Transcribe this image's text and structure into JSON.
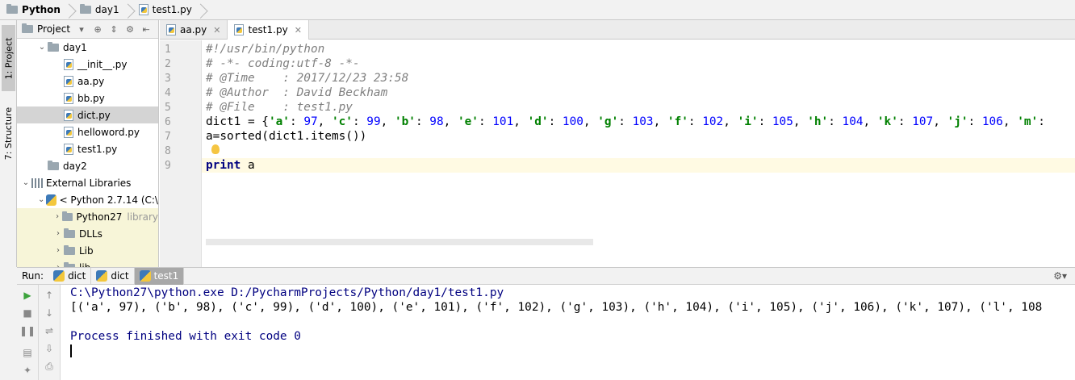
{
  "breadcrumb": {
    "project": "Python",
    "folder": "day1",
    "file": "test1.py"
  },
  "left_strip": {
    "project_tab": "1: Project",
    "structure_tab": "7: Structure"
  },
  "project_panel": {
    "title": "Project",
    "tree": [
      {
        "label": "day1",
        "arrow": "⌄",
        "type": "folder",
        "indent": 1
      },
      {
        "label": "__init__.py",
        "type": "py",
        "indent": 2
      },
      {
        "label": "aa.py",
        "type": "py",
        "indent": 2
      },
      {
        "label": "bb.py",
        "type": "py",
        "indent": 2
      },
      {
        "label": "dict.py",
        "type": "py",
        "indent": 2,
        "selected": true
      },
      {
        "label": "helloword.py",
        "type": "py",
        "indent": 2
      },
      {
        "label": "test1.py",
        "type": "py",
        "indent": 2
      },
      {
        "label": "day2",
        "type": "folder",
        "indent": 1
      },
      {
        "label": "External Libraries",
        "arrow": "⌄",
        "type": "lib",
        "indent": 0
      },
      {
        "label": "< Python 2.7.14 (C:\\",
        "arrow": "⌄",
        "type": "pyenv",
        "indent": 1
      },
      {
        "label": "Python27",
        "extra": "library",
        "arrow": "›",
        "type": "folder",
        "indent": 2,
        "ext": true
      },
      {
        "label": "DLLs",
        "arrow": "›",
        "type": "folder",
        "indent": 2,
        "ext": true
      },
      {
        "label": "Lib",
        "arrow": "›",
        "type": "folder",
        "indent": 2,
        "ext": true
      },
      {
        "label": "lib",
        "arrow": "›",
        "type": "folder",
        "indent": 2,
        "ext": true
      }
    ]
  },
  "editor_tabs": [
    {
      "label": "aa.py",
      "active": false
    },
    {
      "label": "test1.py",
      "active": true
    }
  ],
  "editor": {
    "line_numbers": [
      "1",
      "2",
      "3",
      "4",
      "5",
      "6",
      "7",
      "8",
      "9"
    ],
    "lines": {
      "l1": "#!/usr/bin/python",
      "l2": "# -*- coding:utf-8 -*-",
      "l3": "# @Time    : 2017/12/23 23:58",
      "l4": "# @Author  : David Beckham",
      "l5": "# @File    : test1.py",
      "l6_start": "dict1 = {",
      "l6_pairs": [
        [
          "'a'",
          "97"
        ],
        [
          "'c'",
          "99"
        ],
        [
          "'b'",
          "98"
        ],
        [
          "'e'",
          "101"
        ],
        [
          "'d'",
          "100"
        ],
        [
          "'g'",
          "103"
        ],
        [
          "'f'",
          "102"
        ],
        [
          "'i'",
          "105"
        ],
        [
          "'h'",
          "104"
        ],
        [
          "'k'",
          "107"
        ],
        [
          "'j'",
          "106"
        ],
        [
          "'m'",
          ""
        ]
      ],
      "l7": "a=sorted(dict1.items())",
      "l9_kw": "print",
      "l9_rest": " a"
    }
  },
  "run_panel": {
    "label": "Run:",
    "tabs": [
      {
        "label": "dict",
        "active": false
      },
      {
        "label": "dict",
        "active": false
      },
      {
        "label": "test1",
        "active": true
      }
    ],
    "output": {
      "cmd": "C:\\Python27\\python.exe D:/PycharmProjects/Python/day1/test1.py",
      "result": "[('a', 97), ('b', 98), ('c', 99), ('d', 100), ('e', 101), ('f', 102), ('g', 103), ('h', 104), ('i', 105), ('j', 106), ('k', 107), ('l', 108",
      "finish": "Process finished with exit code 0"
    }
  }
}
